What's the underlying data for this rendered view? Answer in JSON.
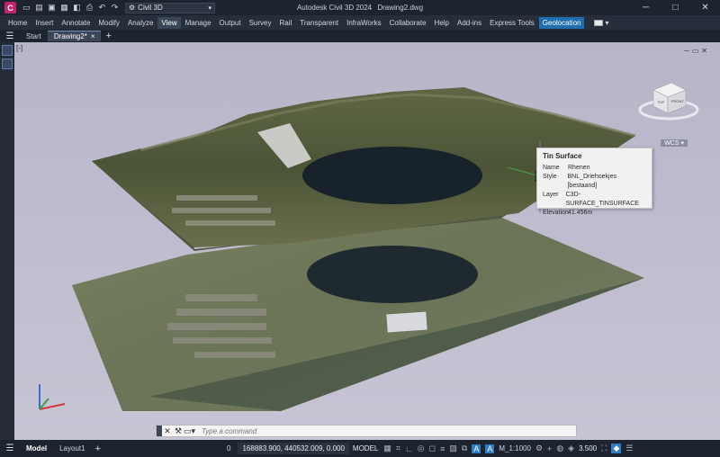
{
  "titlebar": {
    "app_icon_label": "C",
    "workspace": "Civil 3D",
    "app_name": "Autodesk Civil 3D 2024",
    "file_name": "Drawing2.dwg",
    "minimize": "─",
    "maximize": "□",
    "close": "✕"
  },
  "ribbon": {
    "tabs": [
      "Home",
      "Insert",
      "Annotate",
      "Modify",
      "Analyze",
      "View",
      "Manage",
      "Output",
      "Survey",
      "Rail",
      "Transparent",
      "InfraWorks",
      "Collaborate",
      "Help",
      "Add-ins",
      "Express Tools",
      "Geolocation"
    ],
    "active_tab": "View",
    "highlight_tab": "Geolocation"
  },
  "file_tabs": {
    "start": "Start",
    "drawing": "Drawing2*",
    "close": "×",
    "add": "+"
  },
  "viewport": {
    "label": "[-]",
    "ctrl_min": "─",
    "ctrl_restore": "▭",
    "ctrl_close": "✕",
    "wcs": "WCS",
    "cube_top": "TOP",
    "cube_front": "FRONT"
  },
  "tooltip": {
    "title": "Tin Surface",
    "rows": [
      {
        "key": "Name",
        "value": "Rhenen"
      },
      {
        "key": "Style",
        "value": "BNL_Driehoekjes [bestaand]"
      },
      {
        "key": "Layer",
        "value": "C3D-SURFACE_TINSURFACE"
      },
      {
        "key": "Elevation",
        "value": "41.456m"
      }
    ]
  },
  "command_line": {
    "placeholder": "Type a command"
  },
  "statusbar": {
    "model_tab": "Model",
    "layout_tab": "Layout1",
    "add": "+",
    "zero": "0",
    "coordinates": "168883.900, 440532.009, 0.000",
    "model_space": "MODEL",
    "annotation_scale": "M_1:1000",
    "value": "3.500"
  },
  "colors": {
    "accent": "#1f6fb0",
    "app_icon": "#c0246f",
    "viewport_bg": "#bebbce"
  }
}
